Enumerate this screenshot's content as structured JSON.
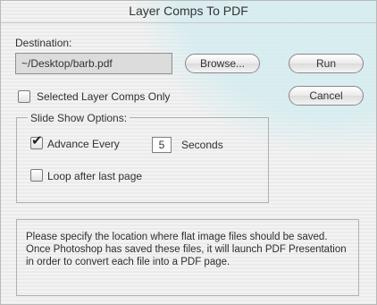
{
  "window": {
    "title": "Layer Comps To PDF"
  },
  "destination": {
    "label": "Destination:",
    "path_value": "~/Desktop/barb.pdf",
    "browse_label": "Browse..."
  },
  "actions": {
    "run_label": "Run",
    "cancel_label": "Cancel"
  },
  "options": {
    "selected_only_label": "Selected Layer Comps Only",
    "selected_only_checked": false
  },
  "slideshow": {
    "group_title": "Slide Show Options:",
    "advance_label": "Advance Every",
    "advance_checked": true,
    "advance_value": "5",
    "seconds_label": "Seconds",
    "loop_label": "Loop after last page",
    "loop_checked": false
  },
  "info": {
    "text": "Please specify the location where flat image files should be saved. Once Photoshop has saved these files, it will launch PDF Presentation in order to convert each file into a PDF page."
  },
  "colors": {
    "glare": "#d2ecf0",
    "panel": "#f1f1f1",
    "border": "#b0b0b0"
  }
}
